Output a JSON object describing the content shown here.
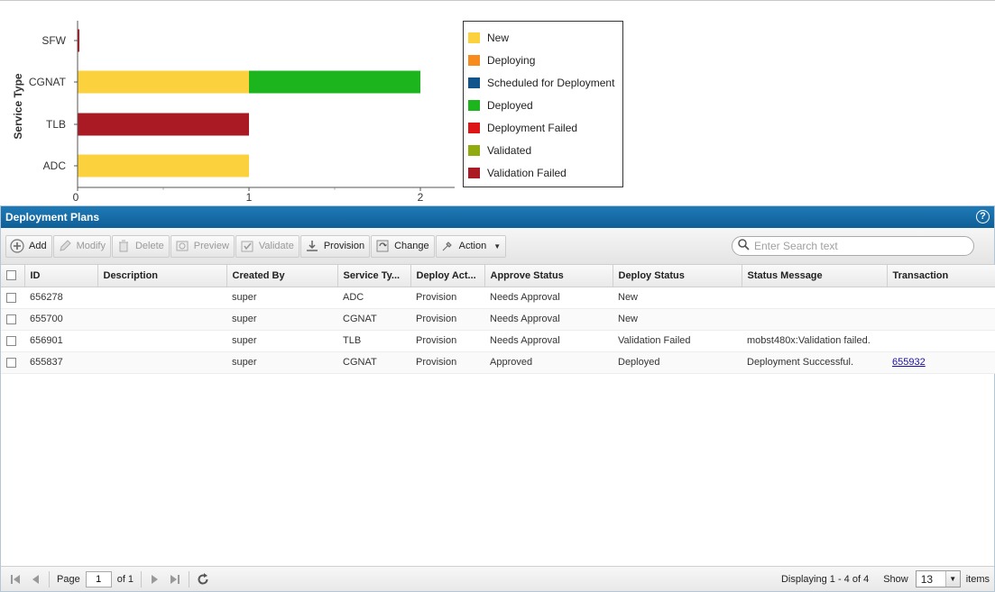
{
  "chart_data": {
    "type": "bar",
    "orientation": "horizontal",
    "stacked": true,
    "ylabel": "Service Type",
    "xlabel": "",
    "categories": [
      "SFW",
      "CGNAT",
      "TLB",
      "ADC"
    ],
    "xlim": [
      0,
      2.2
    ],
    "x_ticks": [
      "0",
      "1",
      "2"
    ],
    "series": [
      {
        "name": "New",
        "color": "#fcd13e",
        "values": [
          0,
          1,
          0,
          1
        ]
      },
      {
        "name": "Deploying",
        "color": "#f78b1e",
        "values": [
          0,
          0,
          0,
          0
        ]
      },
      {
        "name": "Scheduled for Deployment",
        "color": "#11548c",
        "values": [
          0,
          0,
          0,
          0
        ]
      },
      {
        "name": "Deployed",
        "color": "#1db51e",
        "values": [
          0,
          1,
          0,
          0
        ]
      },
      {
        "name": "Deployment Failed",
        "color": "#dc1616",
        "values": [
          0,
          0,
          0,
          0
        ]
      },
      {
        "name": "Validated",
        "color": "#8fab0e",
        "values": [
          0,
          0,
          0,
          0
        ]
      },
      {
        "name": "Validation Failed",
        "color": "#a91a25",
        "values": [
          0.01,
          0,
          1,
          0
        ]
      }
    ],
    "legend_position": "right"
  },
  "panel": {
    "title": "Deployment Plans",
    "help_icon": "question-circle-icon"
  },
  "toolbar": {
    "add": "Add",
    "modify": "Modify",
    "delete": "Delete",
    "preview": "Preview",
    "validate": "Validate",
    "provision": "Provision",
    "change": "Change",
    "action": "Action",
    "search_placeholder": "Enter Search text"
  },
  "table": {
    "columns": [
      "ID",
      "Description",
      "Created By",
      "Service Ty...",
      "Deploy Act...",
      "Approve Status",
      "Deploy Status",
      "Status Message",
      "Transaction"
    ],
    "rows": [
      {
        "id": "656278",
        "description": "",
        "created_by": "super",
        "service_type": "ADC",
        "deploy_action": "Provision",
        "approve_status": "Needs Approval",
        "deploy_status": "New",
        "status_message": "",
        "transaction": ""
      },
      {
        "id": "655700",
        "description": "",
        "created_by": "super",
        "service_type": "CGNAT",
        "deploy_action": "Provision",
        "approve_status": "Needs Approval",
        "deploy_status": "New",
        "status_message": "",
        "transaction": ""
      },
      {
        "id": "656901",
        "description": "",
        "created_by": "super",
        "service_type": "TLB",
        "deploy_action": "Provision",
        "approve_status": "Needs Approval",
        "deploy_status": "Validation Failed",
        "status_message": "mobst480x:Validation failed.",
        "transaction": ""
      },
      {
        "id": "655837",
        "description": "",
        "created_by": "super",
        "service_type": "CGNAT",
        "deploy_action": "Provision",
        "approve_status": "Approved",
        "deploy_status": "Deployed",
        "status_message": "Deployment Successful.",
        "transaction": "655932"
      }
    ]
  },
  "pager": {
    "page_label": "Page",
    "page_value": "1",
    "of_label": "of 1",
    "displaying": "Displaying 1 - 4 of 4",
    "show_label": "Show",
    "show_value": "13",
    "items_label": "items"
  }
}
